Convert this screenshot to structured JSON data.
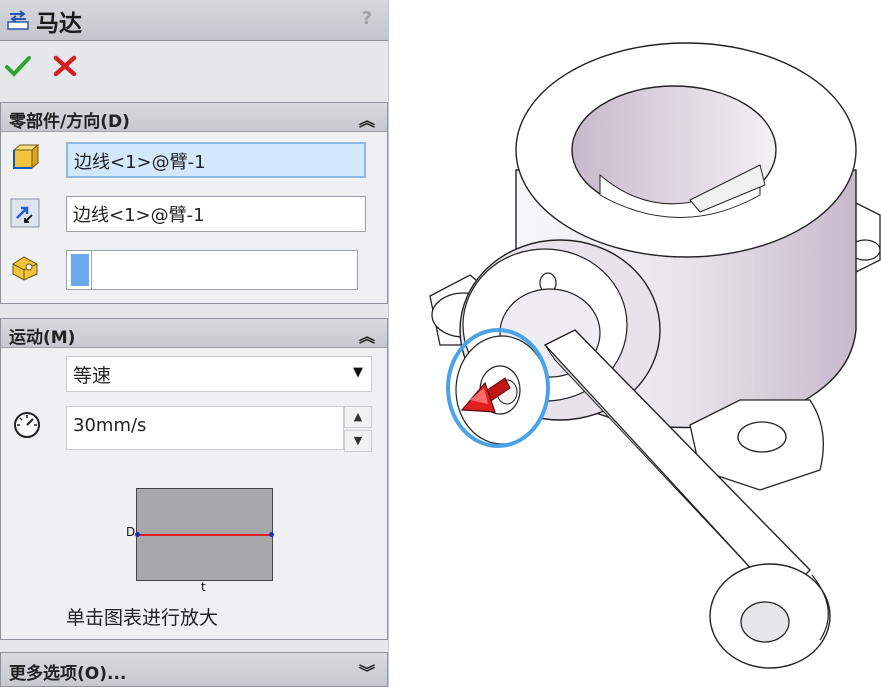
{
  "window": {
    "title": "马达",
    "help_label": "?"
  },
  "actions": {
    "ok": "ok-icon",
    "cancel": "cancel-icon"
  },
  "component_direction": {
    "header": "零部件/方向(D)",
    "position_value": "边线<1>@臂-1",
    "direction_value": "边线<1>@臂-1",
    "component_value": ""
  },
  "motion": {
    "header": "运动(M)",
    "type_selected": "等速",
    "speed_value": "30mm/s",
    "graph_y_label": "D",
    "graph_x_label": "t",
    "graph_hint": "单击图表进行放大"
  },
  "more_options": {
    "header": "更多选项(O)..."
  },
  "colors": {
    "accent_selection": "#d4e8fb",
    "motor_arrow": "#d81818",
    "edge_highlight": "#4aa3e8",
    "graph_line": "#e02020"
  }
}
